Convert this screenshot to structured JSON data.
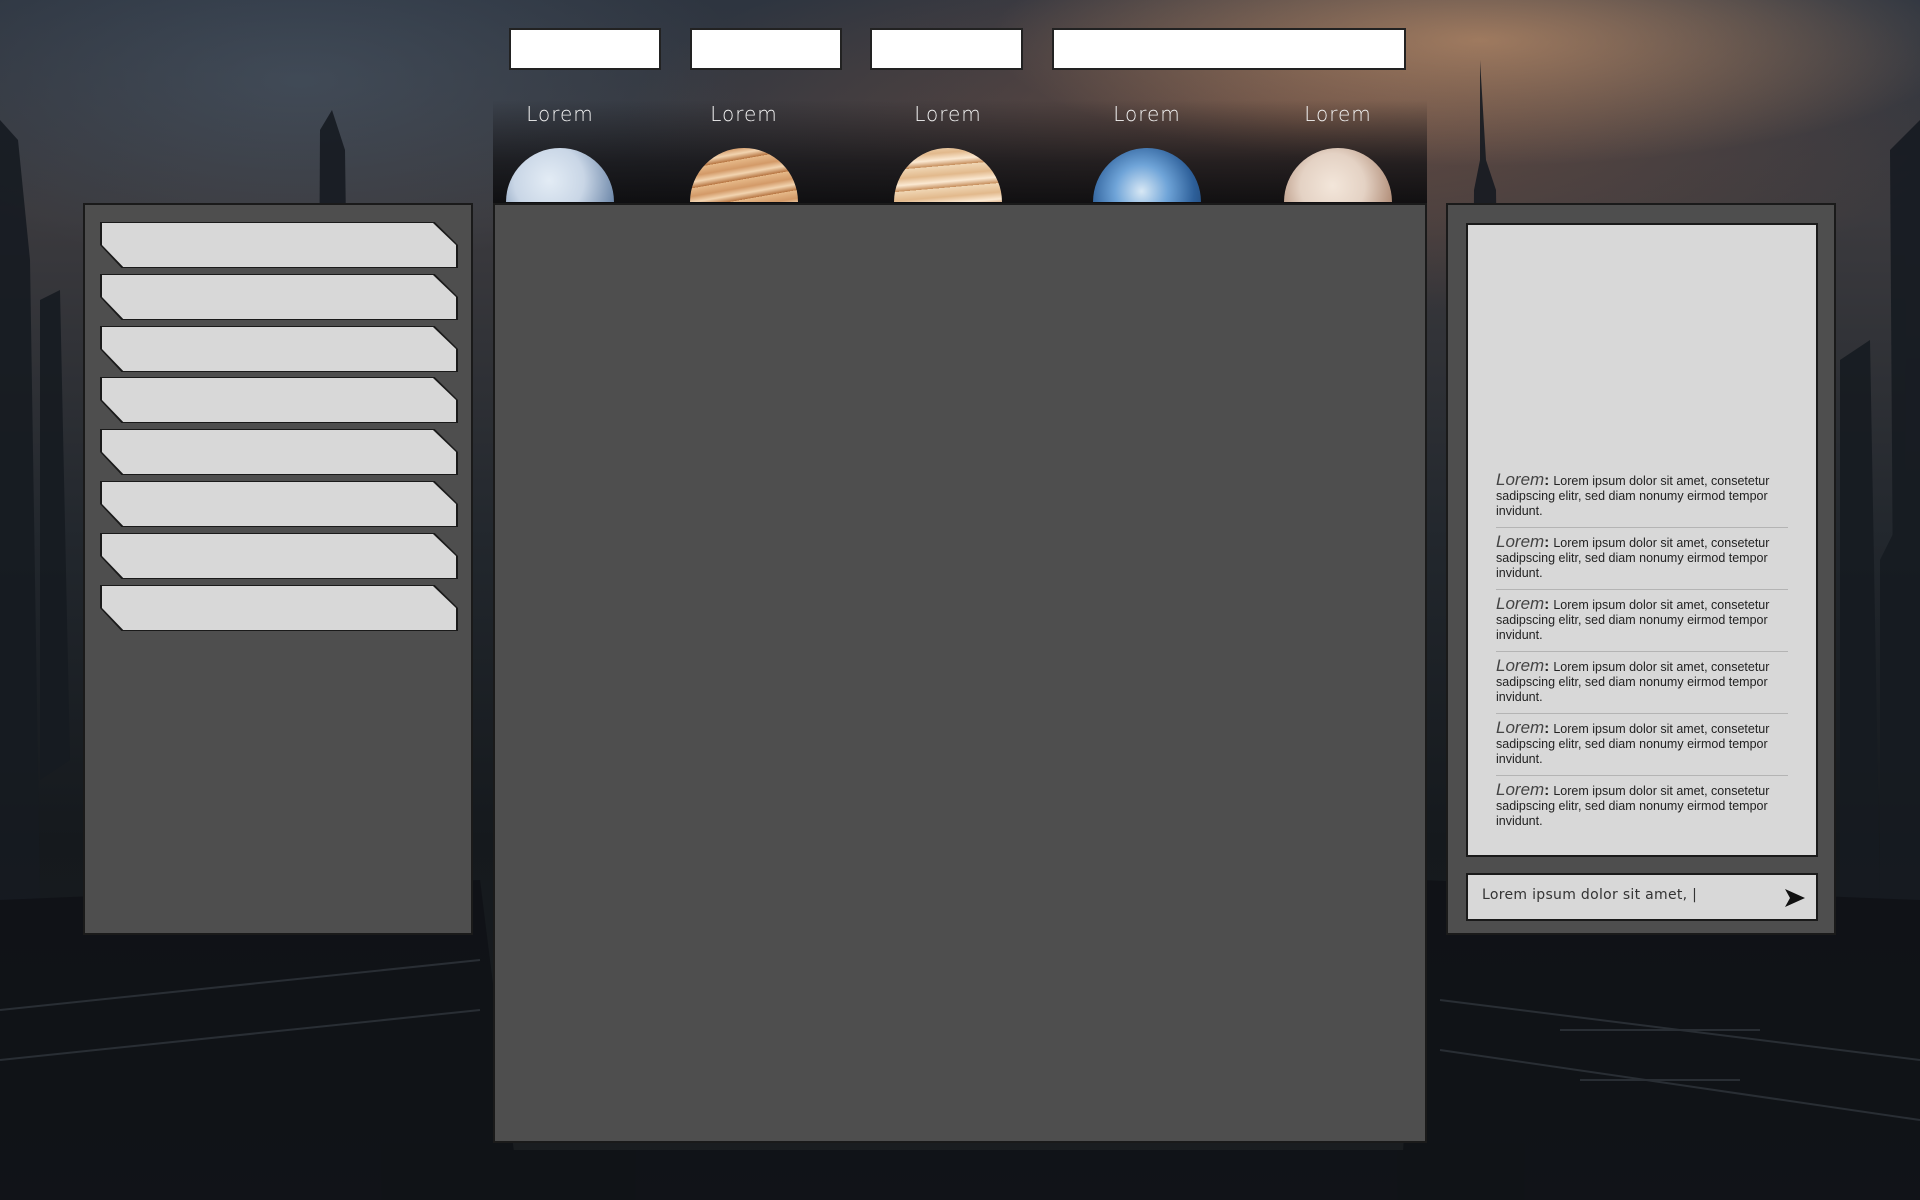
{
  "nav": {
    "boxes": [
      "",
      "",
      "",
      ""
    ]
  },
  "planets": [
    {
      "label": "Lorem",
      "icon": "ice-giant-planet-icon",
      "color_a": "#c9d6e6",
      "color_b": "#4d6c94"
    },
    {
      "label": "Lorem",
      "icon": "gas-giant-planet-icon",
      "color_a": "#e6b989",
      "color_b": "#8a4d28"
    },
    {
      "label": "Lorem",
      "icon": "banded-gas-giant-planet-icon",
      "color_a": "#f0d6b4",
      "color_b": "#a86f3e"
    },
    {
      "label": "Lorem",
      "icon": "earth-like-planet-icon",
      "color_a": "#6fa4d8",
      "color_b": "#1d3f73"
    },
    {
      "label": "Lorem",
      "icon": "rocky-planet-icon",
      "color_a": "#e4d2c4",
      "color_b": "#8b6450"
    }
  ],
  "sidebar": {
    "items": [
      "",
      "",
      "",
      "",
      "",
      "",
      "",
      ""
    ]
  },
  "chat": {
    "messages": [
      {
        "author": "Lorem",
        "text": "Lorem ipsum dolor sit amet, consetetur sadipscing elitr, sed diam nonumy eirmod tempor invidunt."
      },
      {
        "author": "Lorem",
        "text": "Lorem ipsum dolor sit amet, consetetur sadipscing elitr, sed diam nonumy eirmod tempor invidunt."
      },
      {
        "author": "Lorem",
        "text": "Lorem ipsum dolor sit amet, consetetur sadipscing elitr, sed diam nonumy eirmod tempor invidunt."
      },
      {
        "author": "Lorem",
        "text": "Lorem ipsum dolor sit amet, consetetur sadipscing elitr, sed diam nonumy eirmod tempor invidunt."
      },
      {
        "author": "Lorem",
        "text": "Lorem ipsum dolor sit amet, consetetur sadipscing elitr, sed diam nonumy eirmod tempor invidunt."
      },
      {
        "author": "Lorem",
        "text": "Lorem ipsum dolor sit amet, consetetur sadipscing elitr, sed diam nonumy eirmod tempor invidunt."
      }
    ],
    "input_value": "Lorem ipsum dolor sit amet, |",
    "send_icon": "send-arrow-icon"
  },
  "colors": {
    "panel": "#4e4e4e",
    "item": "#d8d8d8",
    "border": "#1a1a1a"
  }
}
